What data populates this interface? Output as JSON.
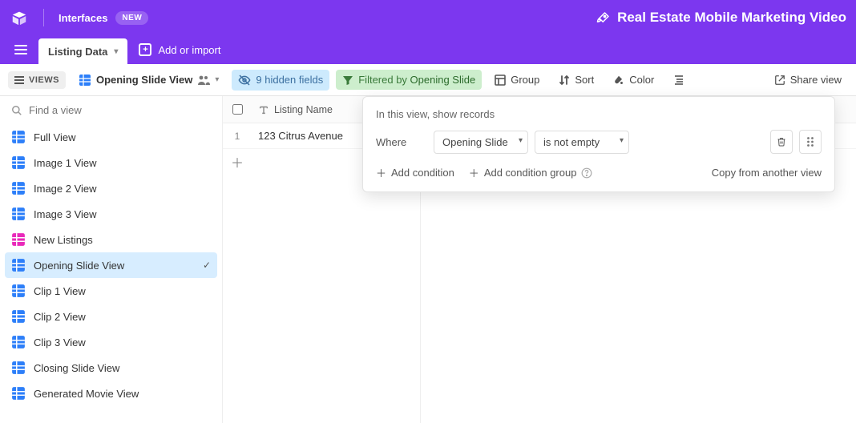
{
  "header": {
    "interfaces_label": "Interfaces",
    "new_badge": "NEW",
    "project_title": "Real Estate Mobile Marketing Video"
  },
  "tabs": {
    "active_tab": "Listing Data",
    "add_or_import": "Add or import"
  },
  "toolbar": {
    "views_btn": "VIEWS",
    "current_view": "Opening Slide View",
    "hidden_fields": "9 hidden fields",
    "filtered_prefix": "Filtered by ",
    "filtered_field": "Opening Slide",
    "group": "Group",
    "sort": "Sort",
    "color": "Color",
    "share": "Share view"
  },
  "sidebar": {
    "search_placeholder": "Find a view",
    "items": [
      {
        "label": "Full View",
        "icon": "blue"
      },
      {
        "label": "Image 1 View",
        "icon": "blue"
      },
      {
        "label": "Image 2 View",
        "icon": "blue"
      },
      {
        "label": "Image 3 View",
        "icon": "blue"
      },
      {
        "label": "New Listings",
        "icon": "pink"
      },
      {
        "label": "Opening Slide View",
        "icon": "blue",
        "active": true
      },
      {
        "label": "Clip 1 View",
        "icon": "blue"
      },
      {
        "label": "Clip 2 View",
        "icon": "blue"
      },
      {
        "label": "Clip 3 View",
        "icon": "blue"
      },
      {
        "label": "Closing Slide View",
        "icon": "blue"
      },
      {
        "label": "Generated Movie View",
        "icon": "blue"
      }
    ]
  },
  "table": {
    "columns": [
      "Listing Name"
    ],
    "rows": [
      {
        "num": "1",
        "listing_name": "123 Citrus Avenue"
      }
    ]
  },
  "filter_popover": {
    "description": "In this view, show records",
    "where_label": "Where",
    "field": "Opening Slide",
    "operator": "is not empty",
    "add_condition": "Add condition",
    "add_group": "Add condition group",
    "copy": "Copy from another view"
  }
}
